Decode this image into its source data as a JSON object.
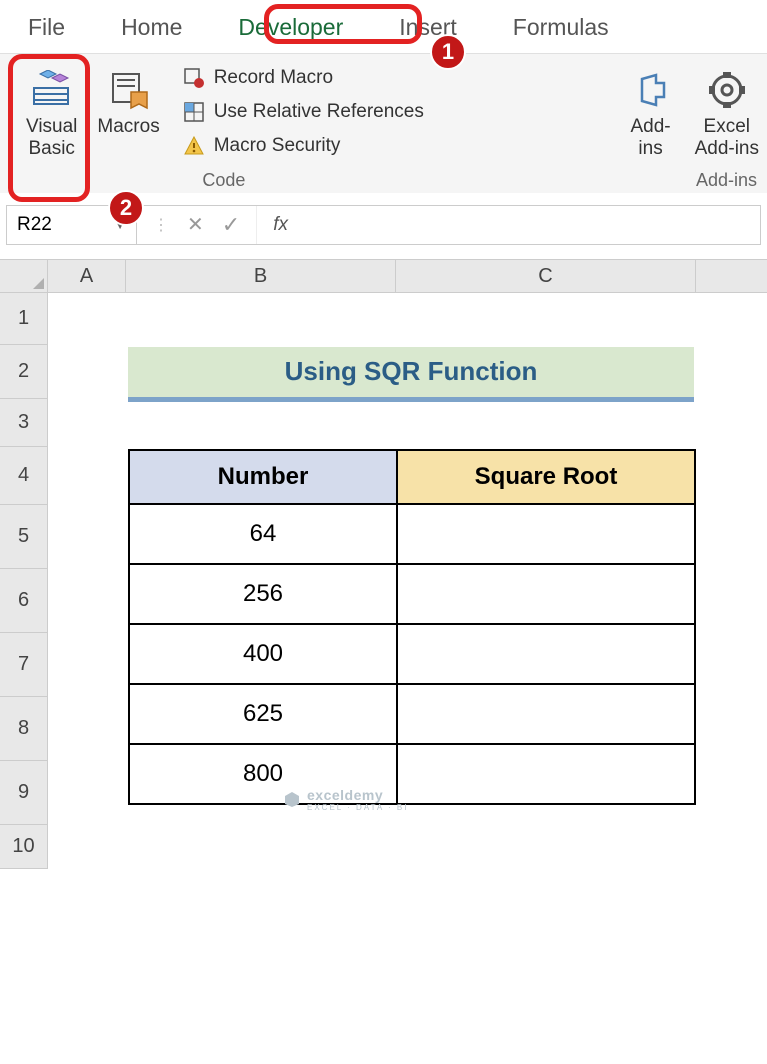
{
  "tabs": {
    "file": "File",
    "home": "Home",
    "developer": "Developer",
    "insert": "Insert",
    "formulas": "Formulas"
  },
  "ribbon": {
    "visual_basic": "Visual\nBasic",
    "macros": "Macros",
    "record_macro": "Record Macro",
    "use_relative": "Use Relative References",
    "macro_security": "Macro Security",
    "code_group": "Code",
    "addins": "Add-\nins",
    "excel_addins": "Excel\nAdd-ins",
    "addins_group": "Add-ins"
  },
  "annotations": {
    "one": "1",
    "two": "2"
  },
  "formula_bar": {
    "name_box": "R22",
    "fx": "fx"
  },
  "columns": {
    "A": "A",
    "B": "B",
    "C": "C"
  },
  "rows": {
    "r1": "1",
    "r2": "2",
    "r3": "3",
    "r4": "4",
    "r5": "5",
    "r6": "6",
    "r7": "7",
    "r8": "8",
    "r9": "9",
    "r10": "10"
  },
  "title": "Using SQR Function",
  "table": {
    "header_number": "Number",
    "header_sqrt": "Square Root",
    "rows": [
      {
        "number": "64",
        "sqrt": ""
      },
      {
        "number": "256",
        "sqrt": ""
      },
      {
        "number": "400",
        "sqrt": ""
      },
      {
        "number": "625",
        "sqrt": ""
      },
      {
        "number": "800",
        "sqrt": ""
      }
    ]
  },
  "watermark": {
    "main": "exceldemy",
    "sub": "EXCEL · DATA · BI"
  }
}
